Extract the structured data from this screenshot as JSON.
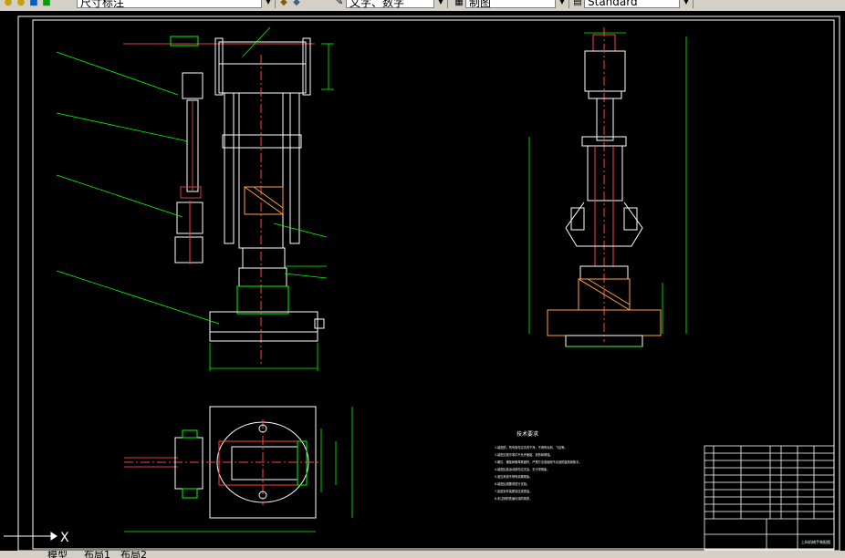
{
  "toolbar": {
    "dim_style": "尺寸标注",
    "text_style": "文字、数字",
    "table_style": "制图",
    "plot_style": "Standard"
  },
  "drawing": {
    "notes_title": "技术要求",
    "notes": [
      "1.装配前，所有零件应清洗干净，不得有毛刺、飞边等。",
      "2.装配过程中零件不允许磕碰、划伤和锈蚀。",
      "3.螺钉、螺栓和螺母紧固时，严禁打击或使用不合适的旋具和扳手。",
      "4.装配后各运动部件应灵活，无卡滞现象。",
      "5.液压系统不得有渗漏现象。",
      "6.装配后按要求进行试验。",
      "7.各密封件装配前应浸透油。",
      "8.未注明的表面均涂防锈漆。"
    ],
    "title_block": "上料机械手装配图"
  },
  "ucs": {
    "x_label": "X"
  },
  "tabs": [
    "模型",
    "布局1",
    "布局2"
  ]
}
